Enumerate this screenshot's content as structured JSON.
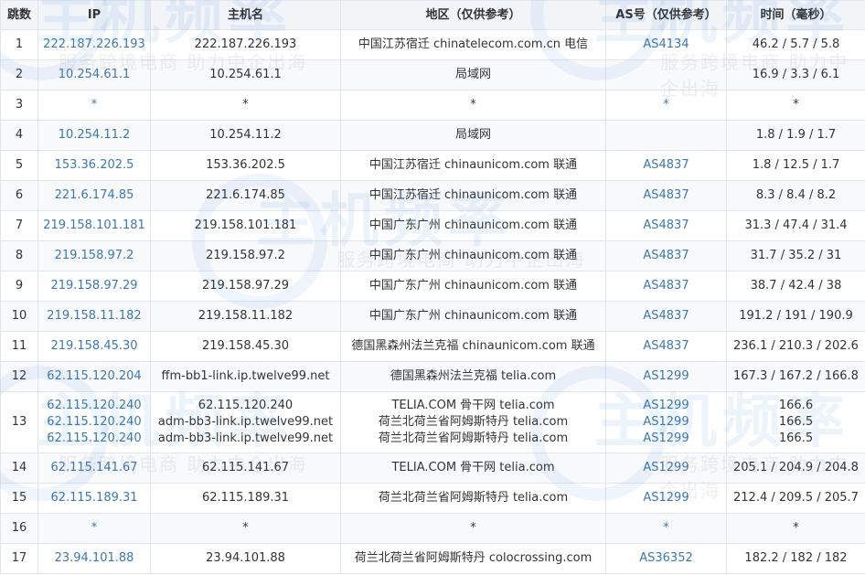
{
  "headers": [
    "跳数",
    "IP",
    "主机名",
    "地区（仅供参考）",
    "AS号（仅供参考）",
    "时间（毫秒）"
  ],
  "rows": [
    {
      "hop": "1",
      "ip": [
        "222.187.226.193"
      ],
      "host": [
        "222.187.226.193"
      ],
      "region": [
        "中国江苏宿迁 chinatelecom.com.cn 电信"
      ],
      "as": [
        "AS4134"
      ],
      "time": [
        "46.2 / 5.7 / 5.8"
      ]
    },
    {
      "hop": "2",
      "ip": [
        "10.254.61.1"
      ],
      "host": [
        "10.254.61.1"
      ],
      "region": [
        "局域网"
      ],
      "as": [
        ""
      ],
      "time": [
        "16.9 / 3.3 / 6.1"
      ]
    },
    {
      "hop": "3",
      "ip": [
        "*"
      ],
      "host": [
        "*"
      ],
      "region": [
        "*"
      ],
      "as": [
        "*"
      ],
      "time": [
        "*"
      ]
    },
    {
      "hop": "4",
      "ip": [
        "10.254.11.2"
      ],
      "host": [
        "10.254.11.2"
      ],
      "region": [
        "局域网"
      ],
      "as": [
        ""
      ],
      "time": [
        "1.8 / 1.9 / 1.7"
      ]
    },
    {
      "hop": "5",
      "ip": [
        "153.36.202.5"
      ],
      "host": [
        "153.36.202.5"
      ],
      "region": [
        "中国江苏宿迁 chinaunicom.com 联通"
      ],
      "as": [
        "AS4837"
      ],
      "time": [
        "1.8 / 12.5 / 1.7"
      ]
    },
    {
      "hop": "6",
      "ip": [
        "221.6.174.85"
      ],
      "host": [
        "221.6.174.85"
      ],
      "region": [
        "中国江苏宿迁 chinaunicom.com 联通"
      ],
      "as": [
        "AS4837"
      ],
      "time": [
        "8.3 / 8.4 / 8.2"
      ]
    },
    {
      "hop": "7",
      "ip": [
        "219.158.101.181"
      ],
      "host": [
        "219.158.101.181"
      ],
      "region": [
        "中国广东广州 chinaunicom.com 联通"
      ],
      "as": [
        "AS4837"
      ],
      "time": [
        "31.3 / 47.4 / 31.4"
      ]
    },
    {
      "hop": "8",
      "ip": [
        "219.158.97.2"
      ],
      "host": [
        "219.158.97.2"
      ],
      "region": [
        "中国广东广州 chinaunicom.com 联通"
      ],
      "as": [
        "AS4837"
      ],
      "time": [
        "31.7 / 35.2 / 31"
      ]
    },
    {
      "hop": "9",
      "ip": [
        "219.158.97.29"
      ],
      "host": [
        "219.158.97.29"
      ],
      "region": [
        "中国广东广州 chinaunicom.com 联通"
      ],
      "as": [
        "AS4837"
      ],
      "time": [
        "38.7 / 42.4 / 38"
      ]
    },
    {
      "hop": "10",
      "ip": [
        "219.158.11.182"
      ],
      "host": [
        "219.158.11.182"
      ],
      "region": [
        "中国广东广州 chinaunicom.com 联通"
      ],
      "as": [
        "AS4837"
      ],
      "time": [
        "191.2 / 191 / 190.9"
      ]
    },
    {
      "hop": "11",
      "ip": [
        "219.158.45.30"
      ],
      "host": [
        "219.158.45.30"
      ],
      "region": [
        "德国黑森州法兰克福 chinaunicom.com 联通"
      ],
      "as": [
        "AS4837"
      ],
      "time": [
        "236.1 / 210.3 / 202.6"
      ]
    },
    {
      "hop": "12",
      "ip": [
        "62.115.120.204"
      ],
      "host": [
        "ffm-bb1-link.ip.twelve99.net"
      ],
      "region": [
        "德国黑森州法兰克福 telia.com"
      ],
      "as": [
        "AS1299"
      ],
      "time": [
        "167.3 / 167.2 / 166.8"
      ]
    },
    {
      "hop": "13",
      "ip": [
        "62.115.120.240",
        "62.115.120.240",
        "62.115.120.240"
      ],
      "host": [
        "62.115.120.240",
        "adm-bb3-link.ip.twelve99.net",
        "adm-bb3-link.ip.twelve99.net"
      ],
      "region": [
        "TELIA.COM 骨干网 telia.com",
        "荷兰北荷兰省阿姆斯特丹 telia.com",
        "荷兰北荷兰省阿姆斯特丹 telia.com"
      ],
      "as": [
        "AS1299",
        "AS1299",
        "AS1299"
      ],
      "time": [
        "166.6",
        "166.5",
        "166.5"
      ]
    },
    {
      "hop": "14",
      "ip": [
        "62.115.141.67"
      ],
      "host": [
        "62.115.141.67"
      ],
      "region": [
        "TELIA.COM 骨干网 telia.com"
      ],
      "as": [
        "AS1299"
      ],
      "time": [
        "205.1 / 204.9 / 204.8"
      ]
    },
    {
      "hop": "15",
      "ip": [
        "62.115.189.31"
      ],
      "host": [
        "62.115.189.31"
      ],
      "region": [
        "荷兰北荷兰省阿姆斯特丹 telia.com"
      ],
      "as": [
        "AS1299"
      ],
      "time": [
        "212.4 / 209.5 / 205.7"
      ]
    },
    {
      "hop": "16",
      "ip": [
        "*"
      ],
      "host": [
        "*"
      ],
      "region": [
        "*"
      ],
      "as": [
        "*"
      ],
      "time": [
        "*"
      ]
    },
    {
      "hop": "17",
      "ip": [
        "23.94.101.88"
      ],
      "host": [
        "23.94.101.88"
      ],
      "region": [
        "荷兰北荷兰省阿姆斯特丹 colocrossing.com"
      ],
      "as": [
        "AS36352"
      ],
      "time": [
        "182.2 / 182 / 182"
      ]
    }
  ],
  "watermark": {
    "logo": "主机频率",
    "slogan": "服务跨境电商 助力中企出海"
  },
  "colors": {
    "link": "#3a78b5",
    "header_bg": "#f2f5f8",
    "border": "#e1e6ee",
    "watermark": "#2f7fd8"
  }
}
